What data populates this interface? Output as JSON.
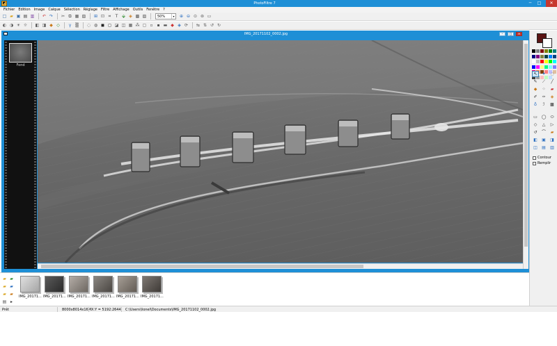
{
  "app": {
    "title": "PhotoFiltre 7",
    "icon": "photofiltre-logo-icon"
  },
  "window_controls": {
    "minimize": "─",
    "maximize": "□",
    "close": "✕"
  },
  "menu": [
    "Fichier",
    "Edition",
    "Image",
    "Calque",
    "Sélection",
    "Réglage",
    "Filtre",
    "Affichage",
    "Outils",
    "Fenêtre",
    "?"
  ],
  "zoom": {
    "value": "50%",
    "arrow": "▾"
  },
  "document": {
    "title": "IMG_20171102_0002.jpg",
    "controls": [
      "–",
      "□",
      "✕"
    ]
  },
  "layers": {
    "fond_label": "Fond"
  },
  "options": {
    "contour": "Contour",
    "remplir": "Remplir"
  },
  "colors": {
    "titlebar": "#1e8fd6",
    "foreground": "#5a1414",
    "background": "#ffffff",
    "palette": [
      "#000000",
      "#808080",
      "#800000",
      "#808000",
      "#008000",
      "#008080",
      "#000080",
      "#800080",
      "#808040",
      "#004040",
      "#0080ff",
      "#004080",
      "#ffffff",
      "#c0c0c0",
      "#ff0000",
      "#ffff00",
      "#00ff00",
      "#00ffff",
      "#0000ff",
      "#ff00ff",
      "#ffff80",
      "#00ff80",
      "#80ffff",
      "#8080ff",
      "#ff0080",
      "#ff8040",
      "#804000",
      "#ff8080",
      "#c0c0ff",
      "#e0c0a0",
      "#404040",
      "#a0a0a0",
      "#ffc0c0",
      "#c0ffc0",
      "#c0e0ff",
      "#f0f0f0"
    ]
  },
  "recent_files": [
    {
      "label": "IMG_20171...",
      "tone": "#c9c9c9"
    },
    {
      "label": "IMG_20171...",
      "tone": "#3d3d3d"
    },
    {
      "label": "IMG_20171...",
      "tone": "#8f8a85"
    },
    {
      "label": "IMG_20171...",
      "tone": "#6e6a66"
    },
    {
      "label": "IMG_20171...",
      "tone": "#837d76"
    },
    {
      "label": "IMG_20171...",
      "tone": "#5e5955"
    }
  ],
  "status": {
    "state": "Prêt",
    "dimensions": "8000x8014x16M",
    "coords": "X:Y = 5192:2644",
    "path": "C:\\Users\\lionel\\Documents\\IMG_20171102_0002.jpg"
  }
}
